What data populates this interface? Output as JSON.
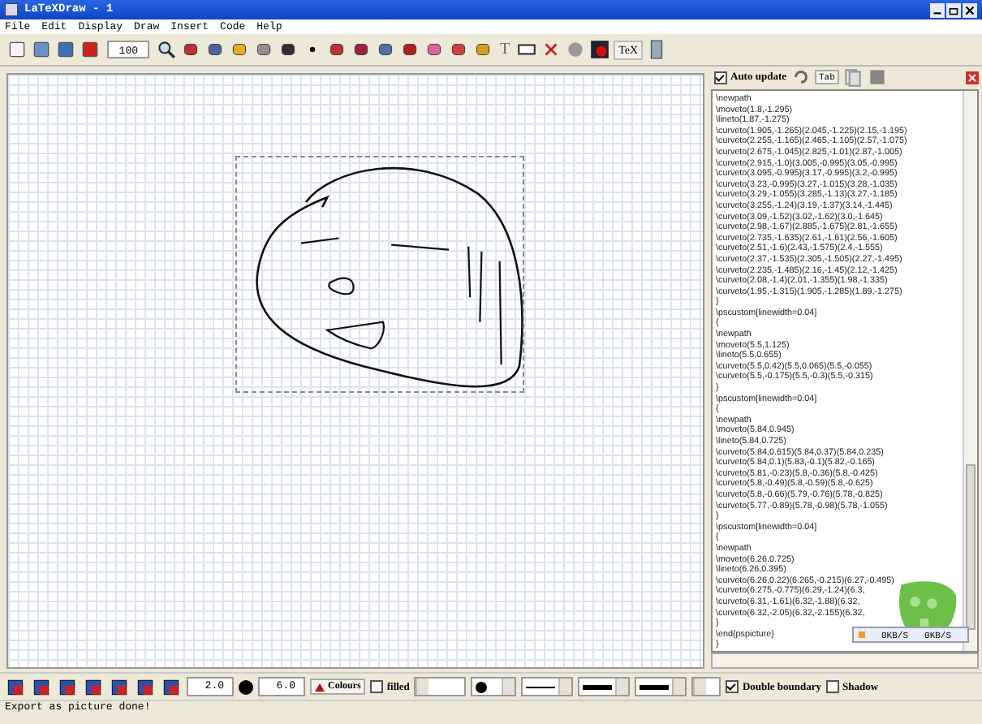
{
  "window": {
    "title": "LaTeXDraw - 1"
  },
  "menu": [
    "File",
    "Edit",
    "Display",
    "Draw",
    "Insert",
    "Code",
    "Help"
  ],
  "toolbar": {
    "zoom": "100",
    "text_tool": "T",
    "tex_button": "TeX"
  },
  "code_panel": {
    "auto_update": {
      "label": "Auto update",
      "checked": true
    },
    "tab_button": "Tab",
    "lines": [
      "\\newpath",
      "\\moveto(1.8,-1.295)",
      "\\lineto(1.87,-1.275)",
      "\\curveto(1.905,-1.265)(2.045,-1.225)(2.15,-1.195)",
      "\\curveto(2.255,-1.165)(2.465,-1.105)(2.57,-1.075)",
      "\\curveto(2.675,-1.045)(2.825,-1.01)(2.87,-1.005)",
      "\\curveto(2.915,-1.0)(3.005,-0.995)(3.05,-0.995)",
      "\\curveto(3.095,-0.995)(3.17,-0.995)(3.2,-0.995)",
      "\\curveto(3.23,-0.995)(3.27,-1.015)(3.28,-1.035)",
      "\\curveto(3.29,-1.055)(3.285,-1.13)(3.27,-1.185)",
      "\\curveto(3.255,-1.24)(3.19,-1.37)(3.14,-1.445)",
      "\\curveto(3.09,-1.52)(3.02,-1.62)(3.0,-1.645)",
      "\\curveto(2.98,-1.67)(2.885,-1.675)(2.81,-1.655)",
      "\\curveto(2.735,-1.635)(2.61,-1.61)(2.56,-1.605)",
      "\\curveto(2.51,-1.6)(2.43,-1.575)(2.4,-1.555)",
      "\\curveto(2.37,-1.535)(2.305,-1.505)(2.27,-1.495)",
      "\\curveto(2.235,-1.485)(2.16,-1.45)(2.12,-1.425)",
      "\\curveto(2.08,-1.4)(2.01,-1.355)(1.98,-1.335)",
      "\\curveto(1.95,-1.315)(1.905,-1.285)(1.89,-1.275)",
      "}",
      "\\pscustom[linewidth=0.04]",
      "{",
      "\\newpath",
      "\\moveto(5.5,1.125)",
      "\\lineto(5.5,0.655)",
      "\\curveto(5.5,0.42)(5.5,0.065)(5.5,-0.055)",
      "\\curveto(5.5,-0.175)(5.5,-0.3)(5.5,-0.315)",
      "}",
      "\\pscustom[linewidth=0.04]",
      "{",
      "\\newpath",
      "\\moveto(5.84,0.945)",
      "\\lineto(5.84,0.725)",
      "\\curveto(5.84,0.615)(5.84,0.37)(5.84,0.235)",
      "\\curveto(5.84,0.1)(5.83,-0.1)(5.82,-0.165)",
      "\\curveto(5.81,-0.23)(5.8,-0.36)(5.8,-0.425)",
      "\\curveto(5.8,-0.49)(5.8,-0.59)(5.8,-0.625)",
      "\\curveto(5.8,-0.66)(5.79,-0.76)(5.78,-0.825)",
      "\\curveto(5.77,-0.89)(5.78,-0.98)(5.78,-1.055)",
      "}",
      "\\pscustom[linewidth=0.04]",
      "{",
      "\\newpath",
      "\\moveto(6.26,0.725)",
      "\\lineto(6.26,0.395)",
      "\\curveto(6.26,0.22)(6.265,-0.215)(6.27,-0.495)",
      "\\curveto(6.275,-0.775)(6.29,-1.24)(6.3,",
      "\\curveto(6.31,-1.61)(6.32,-1.88)(6.32,",
      "\\curveto(6.32,-2.05)(6.32,-2.155)(6.32,",
      "}",
      "\\end{pspicture}",
      "}"
    ]
  },
  "overlay": {
    "speeds": [
      "0KB/S",
      "0KB/S"
    ]
  },
  "bottom_toolbar": {
    "thickness": "2.0",
    "dot_size": "6.0",
    "colours": "Colours",
    "filled": {
      "label": "filled",
      "checked": false
    },
    "double_boundary": {
      "label": "Double boundary",
      "checked": true
    },
    "shadow": {
      "label": "Shadow",
      "checked": false
    }
  },
  "status_bar": "Export as picture done!"
}
